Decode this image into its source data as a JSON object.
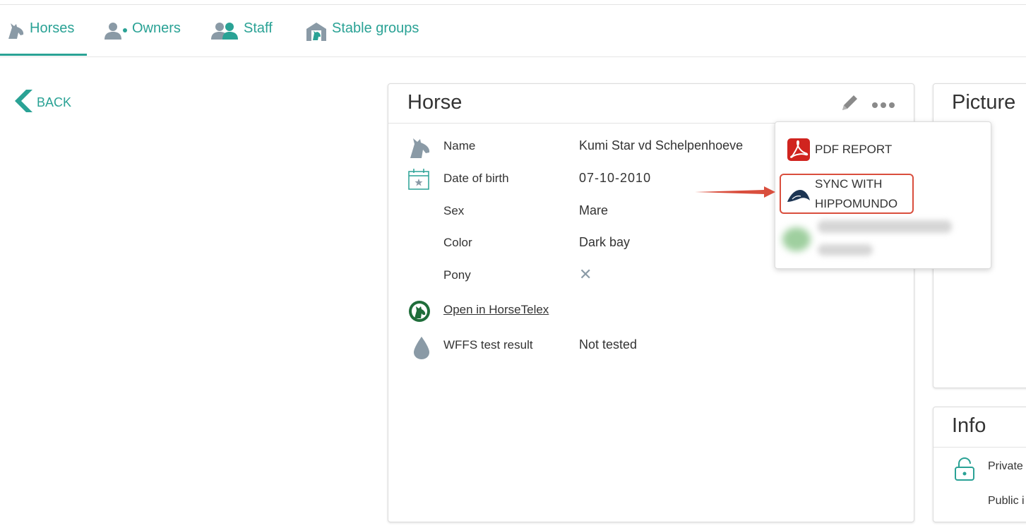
{
  "tabs": [
    {
      "label": "Horses",
      "active": true
    },
    {
      "label": "Owners",
      "active": false
    },
    {
      "label": "Staff",
      "active": false
    },
    {
      "label": "Stable groups",
      "active": false
    }
  ],
  "back_label": "BACK",
  "horse_card": {
    "title": "Horse",
    "fields": [
      {
        "label": "Name",
        "value": "Kumi Star vd Schelpenhoeve"
      },
      {
        "label": "Date of birth",
        "value": "07-10-2010"
      },
      {
        "label": "Sex",
        "value": "Mare"
      },
      {
        "label": "Color",
        "value": "Dark bay"
      },
      {
        "label": "Pony",
        "value": "✕"
      }
    ],
    "horsetelex_link": "Open in HorseTelex",
    "wffs": {
      "label": "WFFS test result",
      "value": "Not tested"
    }
  },
  "menu": {
    "pdf_report": "PDF REPORT",
    "sync_line1": "SYNC WITH",
    "sync_line2": "HIPPOMUNDO"
  },
  "picture_card": {
    "title": "Picture"
  },
  "info_card": {
    "title": "Info",
    "private_label": "Private",
    "public_label": "Public i"
  },
  "colors": {
    "accent": "#2aa295",
    "highlight": "#d94e3d",
    "pdf_red": "#d0241f",
    "hippomundo_navy": "#1c3553"
  }
}
